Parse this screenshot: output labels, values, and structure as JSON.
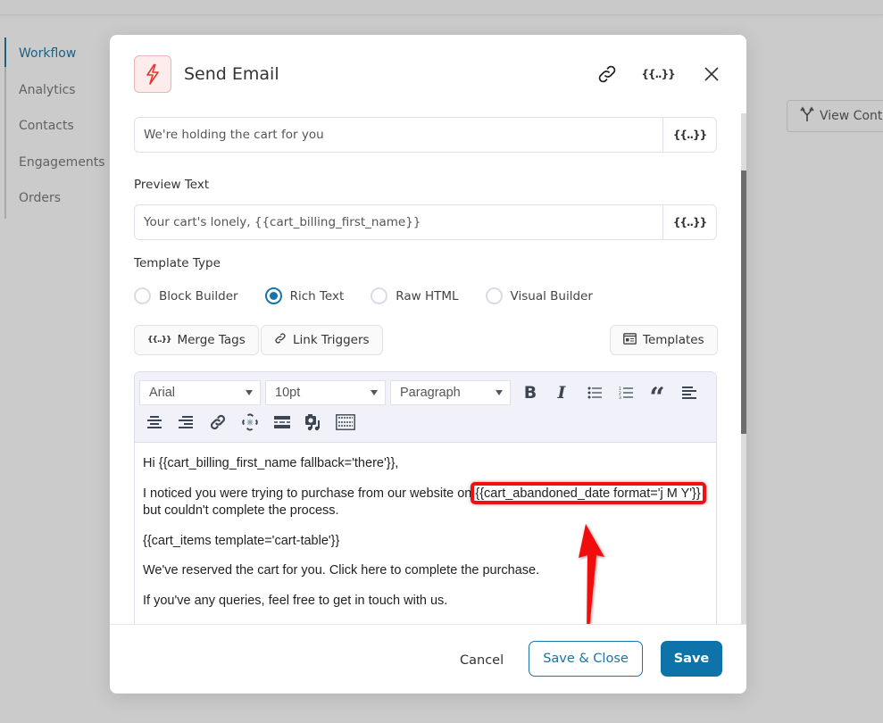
{
  "sidebar": {
    "items": [
      {
        "label": "Workflow",
        "active": true
      },
      {
        "label": "Analytics"
      },
      {
        "label": "Contacts"
      },
      {
        "label": "Engagements"
      },
      {
        "label": "Orders"
      }
    ]
  },
  "background": {
    "view_contacts_label": "View Conta"
  },
  "modal": {
    "title": "Send Email",
    "header_icons": [
      "lightning-icon",
      "link-icon",
      "merge-tags-icon",
      "close-icon"
    ],
    "merge_tag_glyph": "{{..}}",
    "subject": {
      "value": "We're holding the cart for you"
    },
    "preview_text": {
      "label": "Preview Text",
      "value": "Your cart's lonely, {{cart_billing_first_name}}"
    },
    "template_type": {
      "label": "Template Type",
      "options": [
        "Block Builder",
        "Rich Text",
        "Raw HTML",
        "Visual Builder"
      ],
      "selected": "Rich Text"
    },
    "buttons": {
      "merge_tags": "Merge Tags",
      "link_triggers": "Link Triggers",
      "templates": "Templates"
    },
    "editor": {
      "font": "Arial",
      "size": "10pt",
      "block": "Paragraph",
      "toolbar_row1": [
        "bold",
        "italic",
        "bullet-list",
        "numbered-list",
        "blockquote",
        "align-left"
      ],
      "toolbar_row2": [
        "align-center",
        "align-right",
        "insert-link",
        "remove-link",
        "horizontal-rule",
        "insert-media",
        "toggle-toolbar"
      ],
      "bold_glyph": "B",
      "italic_glyph": "I",
      "quote_glyph": "“",
      "content": {
        "p1": "Hi {{cart_billing_first_name fallback='there'}},",
        "p2_before": "I noticed you were trying to purchase from our website on ",
        "p2_highlight": "{{cart_abandoned_date format='j M Y'}}",
        "p2_after": "but couldn't complete the process.",
        "p3": "{{cart_items template='cart-table'}}",
        "p4": "We've reserved the cart for you. Click here to complete the purchase.",
        "p5": "If you've any queries, feel free to get in touch with us."
      }
    },
    "footer": {
      "cancel": "Cancel",
      "save_close": "Save & Close",
      "save": "Save"
    },
    "colors": {
      "primary": "#0e73a8",
      "accent_red": "#e0362d",
      "highlight": "#f10f0f"
    }
  }
}
